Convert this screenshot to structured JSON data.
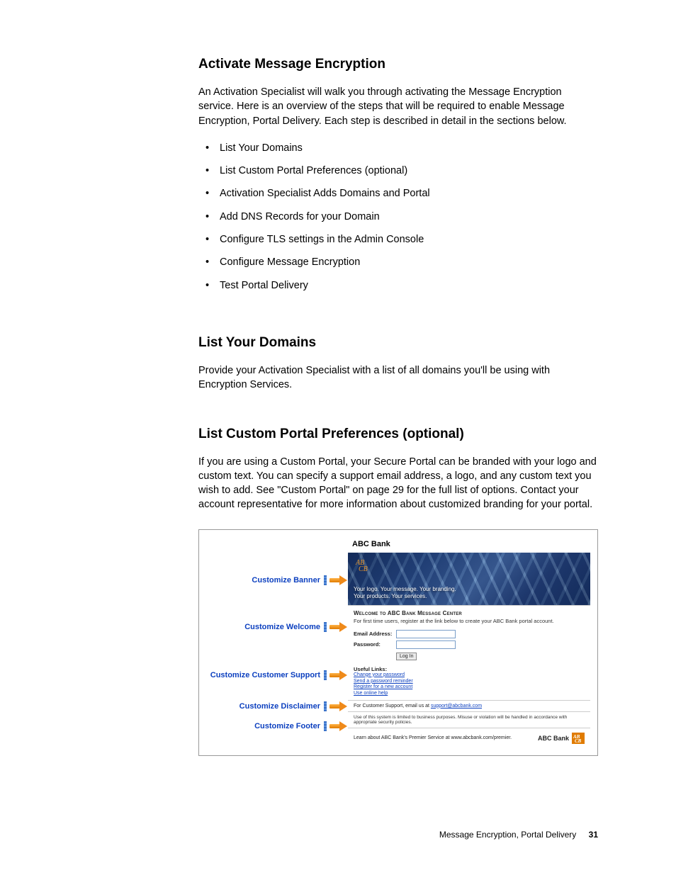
{
  "section1": {
    "heading": "Activate Message Encryption",
    "intro": "An Activation Specialist will walk you through activating the Message Encryption service. Here is an overview of the steps that will be required to enable Message Encryption, Portal Delivery. Each step is described in detail in the sections below.",
    "bullets": [
      "List Your Domains",
      "List Custom Portal Preferences (optional)",
      "Activation Specialist Adds Domains and Portal",
      "Add DNS Records for your Domain",
      "Configure TLS settings in the Admin Console",
      "Configure Message Encryption",
      "Test Portal Delivery"
    ]
  },
  "section2": {
    "heading": "List Your Domains",
    "text": "Provide your Activation Specialist with a list of all domains you'll be using with Encryption Services."
  },
  "section3": {
    "heading": "List Custom Portal Preferences (optional)",
    "text": "If you are using a Custom Portal, your Secure Portal can be branded with your logo and custom text. You can specify a support email address, a logo, and any custom text you wish to add. See \"Custom Portal\" on page 29 for the full list of options. Contact your account representative for more information about customized branding for your portal."
  },
  "figure": {
    "callouts": {
      "banner": "Customize Banner",
      "welcome": "Customize Welcome",
      "support": "Customize Customer Support",
      "disclaimer": "Customize Disclaimer",
      "footer": "Customize Footer"
    },
    "mock": {
      "brand": "ABC Bank",
      "banner_line1": "Your logo. Your message. Your branding.",
      "banner_line2": "Your products. Your services.",
      "welcome_title": "Welcome to ABC Bank Message Center",
      "welcome_text": "For first time users, register at the link below to create your ABC Bank portal account.",
      "label_email": "Email Address:",
      "label_password": "Password:",
      "login_btn": "Log In",
      "links_title": "Useful Links:",
      "links": [
        "Change your password",
        "Send a password reminder",
        "Register for a new account",
        "Use online help"
      ],
      "support_prefix": "For Customer Support, email us at ",
      "support_email": "support@abcbank.com",
      "disclaimer": "Use of this system is limited to business purposes. Misuse or violation will be handled in accordance with appropriate security policies.",
      "footer_text": "Learn about ABC Bank's Premier Service at www.abcbank.com/premier."
    }
  },
  "footer": {
    "title": "Message Encryption, Portal Delivery",
    "page": "31"
  }
}
